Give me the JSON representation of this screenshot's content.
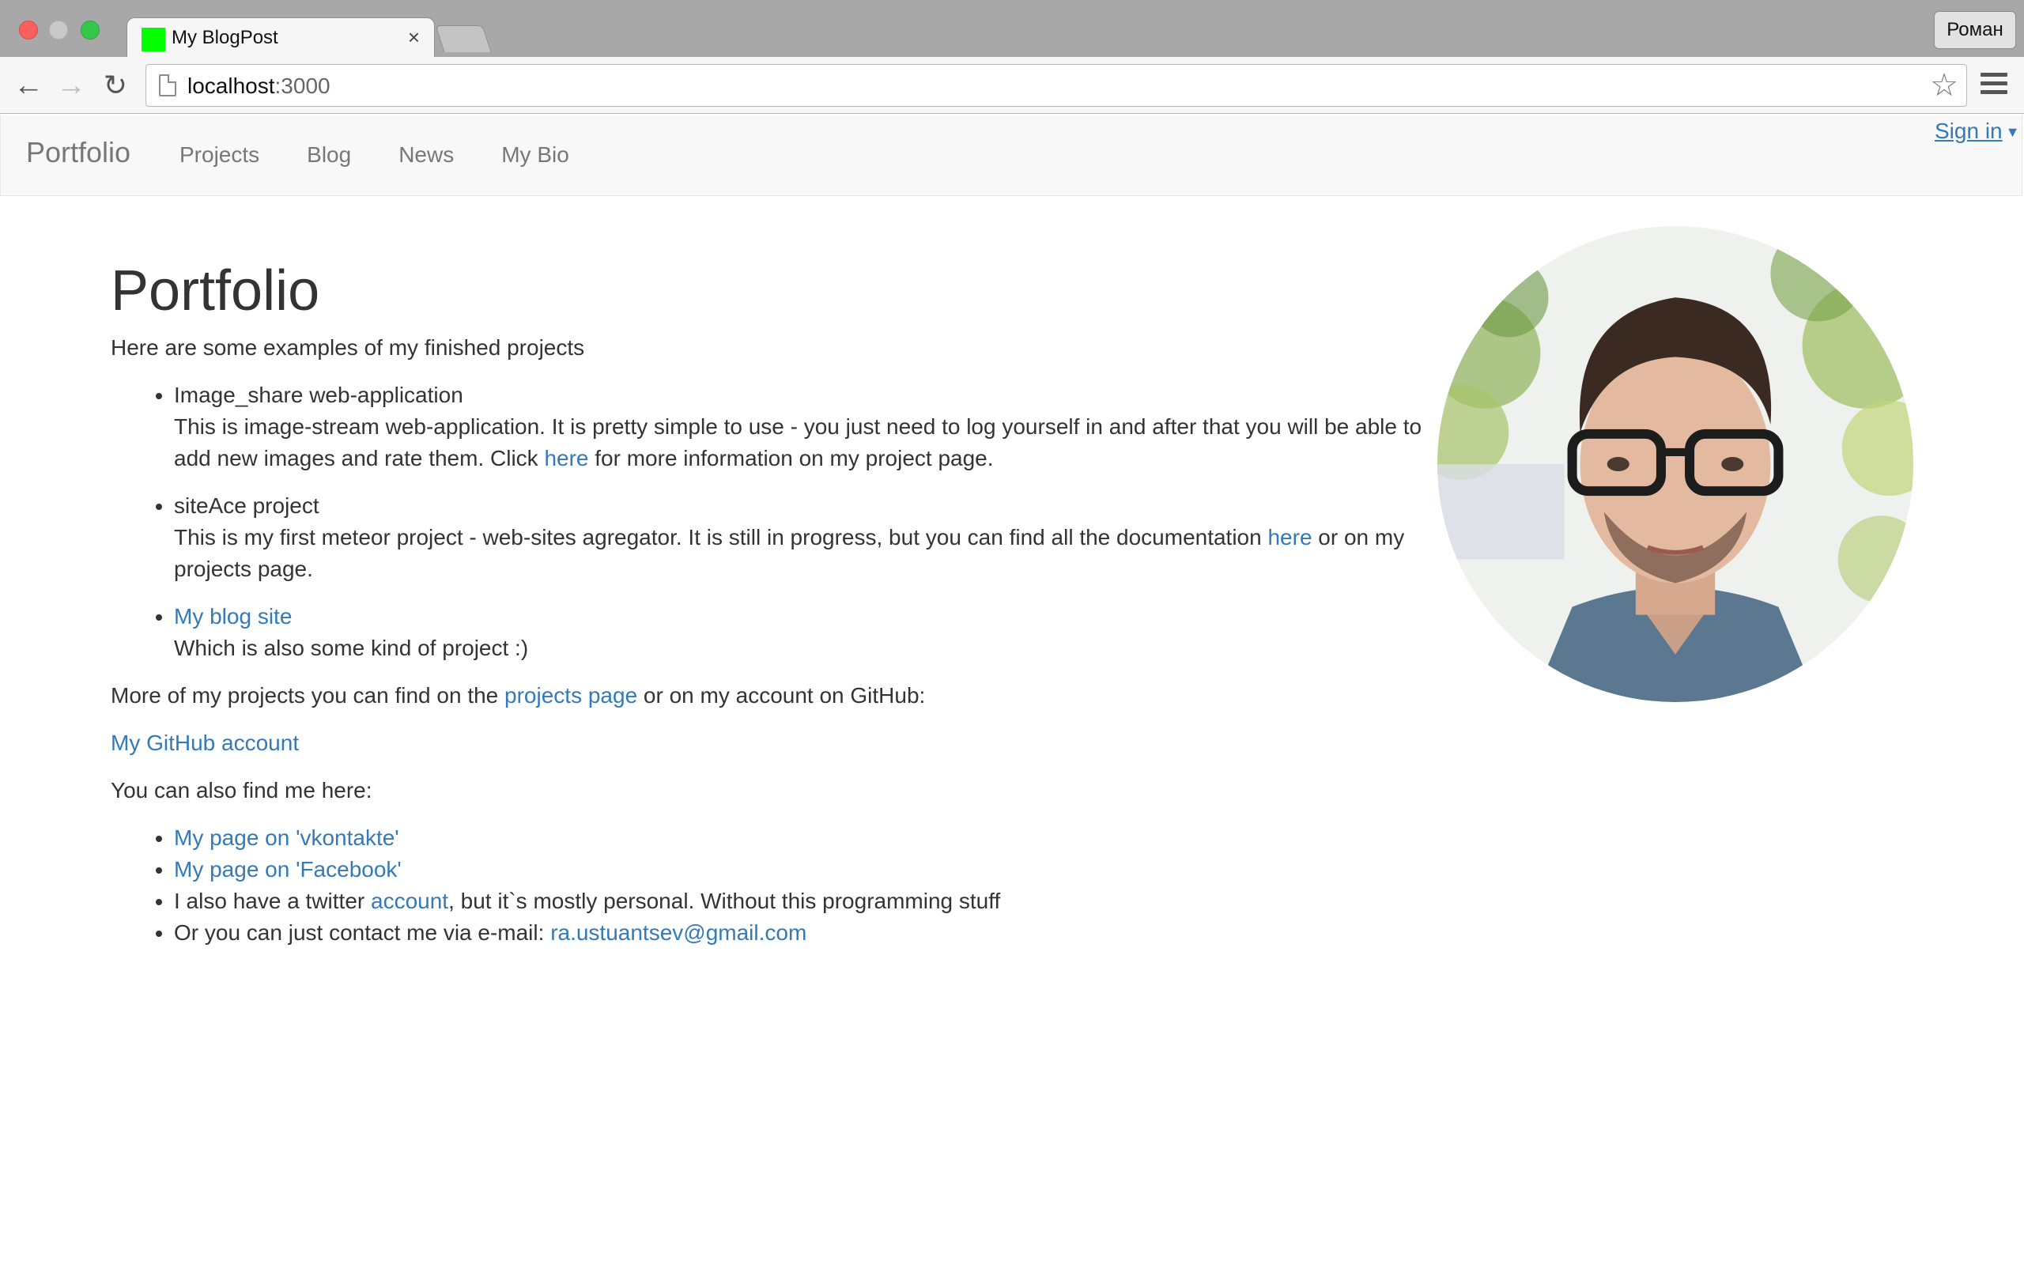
{
  "browser": {
    "tab_title": "My BlogPost",
    "tab_close": "×",
    "profile": "Роман",
    "url_host": "localhost",
    "url_port": ":3000"
  },
  "navbar": {
    "brand": "Portfolio",
    "links": [
      "Projects",
      "Blog",
      "News",
      "My Bio"
    ],
    "signin": "Sign in"
  },
  "main": {
    "title": "Portfolio",
    "intro": "Here are some examples of my finished projects",
    "projects": [
      {
        "name": "Image_share web-application",
        "desc_before": "This is image-stream web-application. It is pretty simple to use - you just need to log yourself in and after that you will be able to add new images and rate them. Click ",
        "link": "here",
        "desc_after": " for more information on my project page."
      },
      {
        "name": "siteAce project",
        "desc_before": "This is my first meteor project - web-sites agregator. It is still in progress, but you can find all the documentation ",
        "link": "here",
        "desc_after": " or on my projects page."
      },
      {
        "name_link": "My blog site",
        "desc": "Which is also some kind of project :)"
      }
    ],
    "more_before": "More of my projects you can find on the ",
    "more_link": "projects page",
    "more_after": " or on my account on GitHub:",
    "github_link": "My GitHub account",
    "find_me": "You can also find me here:",
    "contacts": {
      "vk": "My page on 'vkontakte'",
      "facebook": "My page on 'Facebook'",
      "twitter_before": "I also have a twitter ",
      "twitter_link": "account",
      "twitter_after": ", but it`s mostly personal. Without this programming stuff",
      "email_before": "Or you can just contact me via e-mail: ",
      "email_link": "ra.ustuantsev@gmail.com"
    }
  },
  "colors": {
    "link": "#337ab7",
    "text": "#333333",
    "navbar_bg": "#f8f8f8"
  }
}
